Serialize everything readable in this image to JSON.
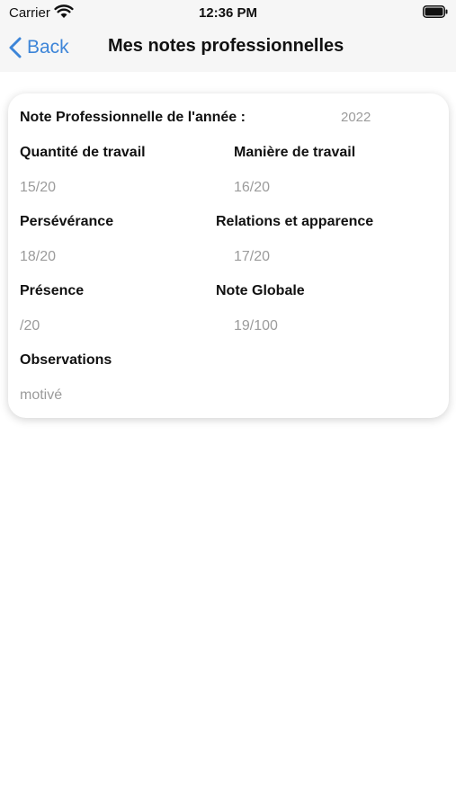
{
  "status_bar": {
    "carrier": "Carrier",
    "time": "12:36 PM"
  },
  "nav": {
    "back_label": "Back",
    "title": "Mes notes professionnelles",
    "accent_color": "#3d85d8"
  },
  "card": {
    "year_label": "Note Professionnelle de l'année :",
    "year_value": "2022",
    "fields": {
      "quantite": {
        "label": "Quantité de travail",
        "value": "15/20"
      },
      "maniere": {
        "label": "Manière de travail",
        "value": "16/20"
      },
      "perseverance": {
        "label": "Persévérance",
        "value": "18/20"
      },
      "relations": {
        "label": "Relations et apparence",
        "value": "17/20"
      },
      "presence": {
        "label": "Présence",
        "value": "/20"
      },
      "globale": {
        "label": "Note Globale",
        "value": "19/100"
      },
      "observations": {
        "label": "Observations",
        "value": "motivé"
      }
    }
  }
}
